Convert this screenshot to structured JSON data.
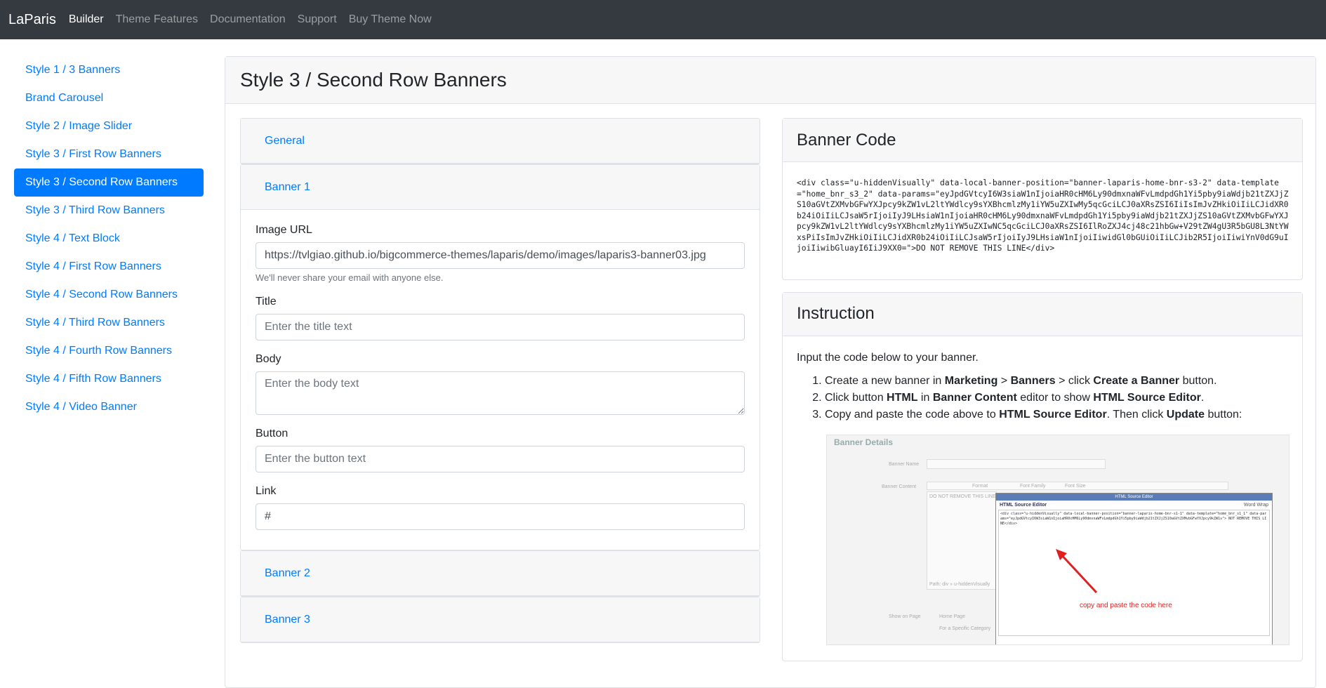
{
  "navbar": {
    "brand": "LaParis",
    "links": [
      "Builder",
      "Theme Features",
      "Documentation",
      "Support",
      "Buy Theme Now"
    ]
  },
  "sidebar": {
    "items": [
      "Style 1 / 3 Banners",
      "Brand Carousel",
      "Style 2 / Image Slider",
      "Style 3 / First Row Banners",
      "Style 3 / Second Row Banners",
      "Style 3 / Third Row Banners",
      "Style 4 / Text Block",
      "Style 4 / First Row Banners",
      "Style 4 / Second Row Banners",
      "Style 4 / Third Row Banners",
      "Style 4 / Fourth Row Banners",
      "Style 4 / Fifth Row Banners",
      "Style 4 / Video Banner"
    ],
    "active_index": 4
  },
  "main": {
    "title": "Style 3 / Second Row Banners"
  },
  "accordion": {
    "general": "General",
    "banner1": "Banner 1",
    "banner2": "Banner 2",
    "banner3": "Banner 3"
  },
  "form": {
    "image_url_label": "Image URL",
    "image_url_value": "https://tvlgiao.github.io/bigcommerce-themes/laparis/demo/images/laparis3-banner03.jpg",
    "image_url_help": "We'll never share your email with anyone else.",
    "title_label": "Title",
    "title_placeholder": "Enter the title text",
    "body_label": "Body",
    "body_placeholder": "Enter the body text",
    "button_label": "Button",
    "button_placeholder": "Enter the button text",
    "link_label": "Link",
    "link_value": "#"
  },
  "banner_code": {
    "title": "Banner Code",
    "code": "<div class=\"u-hiddenVisually\" data-local-banner-position=\"banner-laparis-home-bnr-s3-2\" data-template=\"home_bnr_s3_2\" data-params=\"eyJpdGVtcyI6W3siaW1nIjoiaHR0cHM6Ly90dmxnaWFvLmdpdGh1Yi5pby9iaWdjb21tZXJjZS10aGVtZXMvbGFwYXJpcy9kZW1vL2ltYWdlcy9sYXBhcmlzMy1iYW5uZXIwMy5qcGciLCJ0aXRsZSI6IiIsImJvZHkiOiIiLCJidXR0b24iOiIiLCJsaW5rIjoiIyJ9LHsiaW1nIjoiaHR0cHM6Ly90dmxnaWFvLmdpdGh1Yi5pby9iaWdjb21tZXJjZS10aGVtZXMvbGFwYXJpcy9kZW1vL2ltYWdlcy9sYXBhcmlzMy1iYW5uZXIwNC5qcGciLCJ0aXRsZSI6IlRoZXJ4cj48c21hbGw+V29tZW4gU3R5bGU8L3NtYWxsPiIsImJvZHkiOiIiLCJidXR0b24iOiIiLCJsaW5rIjoiIyJ9LHsiaW1nIjoiIiwidGl0bGUiOiIiLCJib2R5IjoiIiwiYnV0dG9uIjoiIiwibGluayI6IiJ9XX0=\">DO NOT REMOVE THIS LINE</div>"
  },
  "instruction": {
    "title": "Instruction",
    "intro": "Input the code below to your banner.",
    "steps": [
      [
        "Create a new banner in ",
        "Marketing",
        " > ",
        "Banners",
        " > click ",
        "Create a Banner",
        " button."
      ],
      [
        "Click button ",
        "HTML",
        " in ",
        "Banner Content",
        " editor to show ",
        "HTML Source Editor",
        "."
      ],
      [
        "Copy and paste the code above to ",
        "HTML Source Editor",
        ". Then click ",
        "Update",
        " button:"
      ]
    ],
    "screenshot": {
      "title": "Banner Details",
      "banner_name": "Banner Name",
      "banner_content": "Banner Content",
      "show_on_page": "Show on Page",
      "home_page": "Home Page",
      "specific": "For a Specific Category",
      "editor_title": "HTML Source Editor",
      "editor_bar": "HTML Source Editor",
      "word_wrap": "Word Wrap",
      "editor_code": "<div class=\"u-hiddenVisually\" data-local-banner-position=\"banner-laparis-home-bnr-s1-1\" data-template=\"home_bnr_s1_1\" data-params=\"eyJpdGVtcyI6W3siaW1nIjoiaHR0cHM6Ly90dmxnaWFvLmdpdGh1Yi5pby9iaWdjb21tZXJjZS10aGVtZXMvbGFwYXJpcy9kZW1v\"> NOT REMOVE THIS LINE</div>",
      "format": "Format",
      "font_family": "Font Family",
      "font_size": "Font Size",
      "path": "Path: div » u-hiddenVisually",
      "do_not_remove": "DO NOT REMOVE THIS LINE",
      "note": "copy and paste the code here"
    }
  },
  "colors": {
    "navbar_bg": "#343a40",
    "accent": "#007bff",
    "note_red": "#e02020"
  }
}
